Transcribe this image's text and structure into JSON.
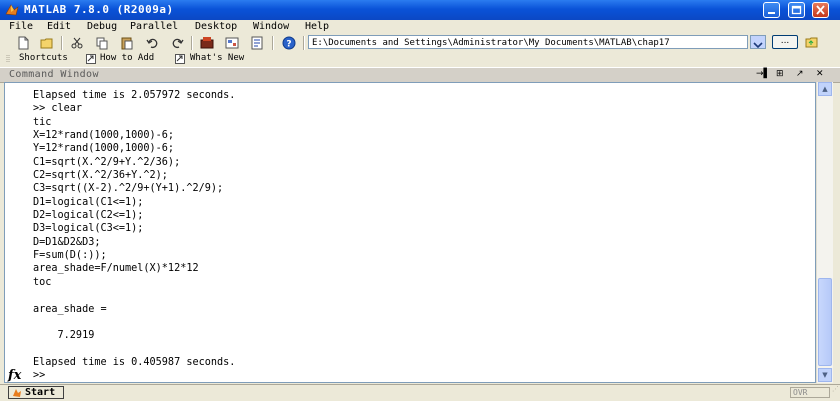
{
  "window": {
    "title": "MATLAB  7.8.0 (R2009a)"
  },
  "menu": [
    "File",
    "Edit",
    "Debug",
    "Parallel",
    "Desktop",
    "Window",
    "Help"
  ],
  "toolbar": {
    "current_folder": "E:\\Documents and Settings\\Administrator\\My Documents\\MATLAB\\chap17",
    "browse_label": "..."
  },
  "shortcuts": {
    "shortcuts_label": "Shortcuts",
    "how_to_add": "How to Add",
    "whats_new": "What's New"
  },
  "command_window": {
    "title": "Command Window",
    "lines": [
      "Elapsed time is 2.057972 seconds.",
      ">> clear",
      "tic",
      "X=12*rand(1000,1000)-6;",
      "Y=12*rand(1000,1000)-6;",
      "C1=sqrt(X.^2/9+Y.^2/36);",
      "C2=sqrt(X.^2/36+Y.^2);",
      "C3=sqrt((X-2).^2/9+(Y+1).^2/9);",
      "D1=logical(C1<=1);",
      "D2=logical(C2<=1);",
      "D3=logical(C3<=1);",
      "D=D1&D2&D3;",
      "F=sum(D(:));",
      "area_shade=F/numel(X)*12*12",
      "toc",
      "",
      "area_shade =",
      "",
      "    7.2919",
      "",
      "Elapsed time is 0.405987 seconds.",
      ">> "
    ],
    "fx_label": "fx"
  },
  "statusbar": {
    "start_label": "Start",
    "ovr_label": "OVR"
  },
  "colors": {
    "titlebar": "#0a53d8",
    "window_bg": "#ece9d8",
    "command_bg": "#ffffff"
  }
}
